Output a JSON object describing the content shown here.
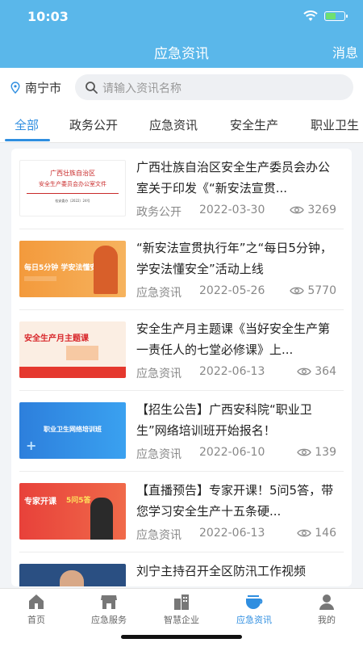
{
  "status_bar": {
    "time": "10:03"
  },
  "header": {
    "title": "应急资讯",
    "messages_label": "消息"
  },
  "location": {
    "city": "南宁市"
  },
  "search": {
    "placeholder": "请输入资讯名称"
  },
  "tabs": [
    {
      "label": "全部",
      "active": true
    },
    {
      "label": "政务公开"
    },
    {
      "label": "应急资讯"
    },
    {
      "label": "安全生产"
    },
    {
      "label": "职业卫生"
    }
  ],
  "articles": [
    {
      "title": "广西壮族自治区安全生产委员会办公室关于印发《“新安法宣贯...",
      "category": "政务公开",
      "date": "2022-03-30",
      "views": "3269",
      "thumb_text": {
        "line1": "广西壮族自治区",
        "line2": "安全生产委员会办公室文件",
        "line3": "桂安委办〔2022〕24号"
      }
    },
    {
      "title": "“新安法宣贯执行年”之“每日5分钟，学安法懂安全”活动上线",
      "category": "应急资讯",
      "date": "2022-05-26",
      "views": "5770",
      "thumb_text": {
        "line1": "每日5分钟 学安法懂安全"
      }
    },
    {
      "title": "安全生产月主题课《当好安全生产第一责任人的七堂必修课》上...",
      "category": "应急资讯",
      "date": "2022-06-13",
      "views": "364",
      "thumb_text": {
        "line1": "安全生产月主题课"
      }
    },
    {
      "title": "【招生公告】广西安科院“职业卫生”网络培训班开始报名！",
      "category": "应急资讯",
      "date": "2022-06-10",
      "views": "139",
      "thumb_text": {
        "line1": "职业卫生网络培训班"
      }
    },
    {
      "title": "【直播预告】专家开课！5问5答，带您学习安全生产十五条硬...",
      "category": "应急资讯",
      "date": "2022-06-13",
      "views": "146",
      "thumb_text": {
        "line1": "专家开课",
        "line2": "5问5答"
      }
    },
    {
      "title": "刘宁主持召开全区防汛工作视频",
      "category": "",
      "date": "",
      "views": ""
    }
  ],
  "tabbar": [
    {
      "label": "首页",
      "icon": "home-icon"
    },
    {
      "label": "应急服务",
      "icon": "store-icon"
    },
    {
      "label": "智慧企业",
      "icon": "building-icon"
    },
    {
      "label": "应急资讯",
      "icon": "news-icon",
      "active": true
    },
    {
      "label": "我的",
      "icon": "person-icon"
    }
  ],
  "colors": {
    "header": "#5ab7ea",
    "accent": "#2f8ee0"
  }
}
